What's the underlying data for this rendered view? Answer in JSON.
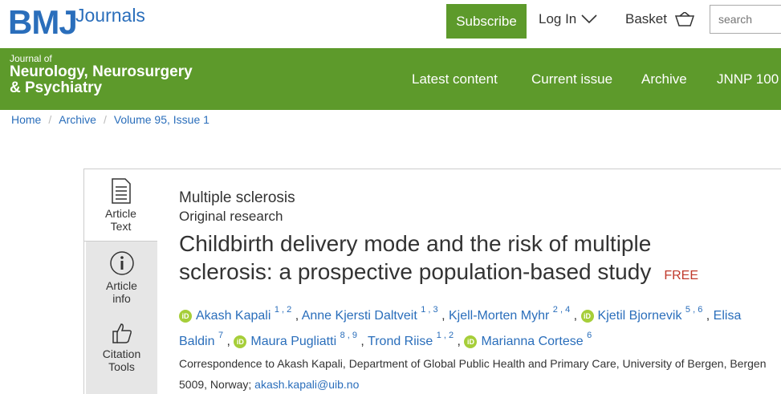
{
  "brand": {
    "logo": "BMJ",
    "sub": "Journals"
  },
  "topbar": {
    "subscribe": "Subscribe",
    "login": "Log In",
    "basket": "Basket",
    "search_placeholder": "search"
  },
  "journal": {
    "prefix": "Journal of",
    "line1": "Neurology, Neurosurgery",
    "line2": "& Psychiatry"
  },
  "nav": [
    "Latest content",
    "Current issue",
    "Archive",
    "JNNP 100"
  ],
  "breadcrumb": [
    "Home",
    "Archive",
    "Volume 95, Issue 1"
  ],
  "tools": [
    {
      "label1": "Article",
      "label2": "Text",
      "icon": "document-icon"
    },
    {
      "label1": "Article",
      "label2": "info",
      "icon": "info-icon"
    },
    {
      "label1": "Citation",
      "label2": "Tools",
      "icon": "thumbs-up-icon"
    }
  ],
  "article": {
    "subject": "Multiple sclerosis",
    "type": "Original research",
    "title": "Childbirth delivery mode and the risk of multiple sclerosis: a prospective population-based study",
    "access": "FREE",
    "authors": [
      {
        "name": "Akash Kapali",
        "affil": "1 , 2",
        "orcid": true
      },
      {
        "name": "Anne Kjersti Daltveit",
        "affil": "1 , 3",
        "orcid": false
      },
      {
        "name": "Kjell-Morten Myhr",
        "affil": "2 , 4",
        "orcid": false
      },
      {
        "name": "Kjetil Bjornevik",
        "affil": "5 , 6",
        "orcid": true
      },
      {
        "name": "Elisa Baldin",
        "affil": "7",
        "orcid": false
      },
      {
        "name": "Maura Pugliatti",
        "affil": "8 , 9",
        "orcid": true
      },
      {
        "name": "Trond Riise",
        "affil": "1 , 2",
        "orcid": false
      },
      {
        "name": "Marianna Cortese",
        "affil": "6",
        "orcid": true
      }
    ],
    "orcid_glyph": "iD",
    "correspondence": "Correspondence to Akash Kapali, Department of Global Public Health and Primary Care, University of Bergen, Bergen 5009, Norway;",
    "email": "akash.kapali@uib.no"
  },
  "colors": {
    "green": "#5d9a2b",
    "blue": "#2a6ebb",
    "orcid": "#a6ce39",
    "free": "#c0392b"
  }
}
